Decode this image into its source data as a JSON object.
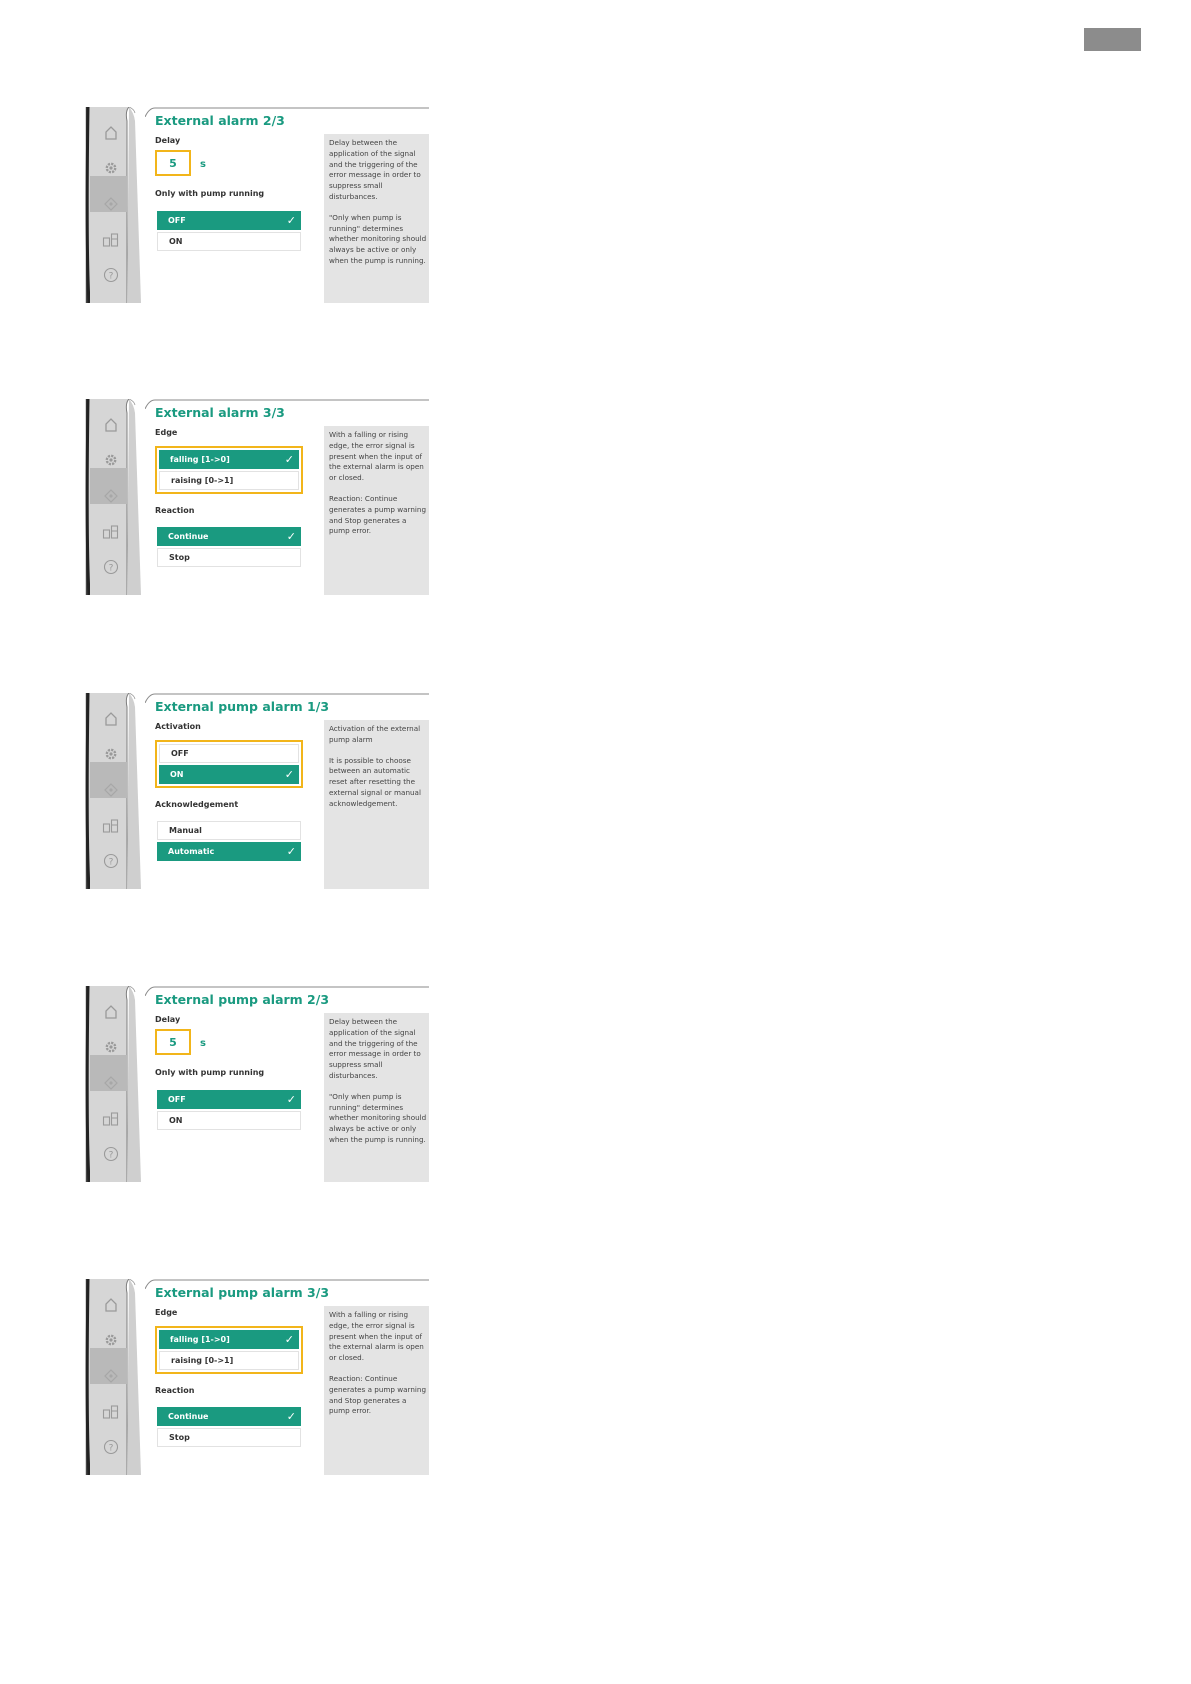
{
  "screens": [
    {
      "title": "External alarm 2/3",
      "delay_label": "Delay",
      "delay_value": "5",
      "delay_unit": "s",
      "group_label": "Only with pump running",
      "options": [
        {
          "label": "OFF",
          "selected": true
        },
        {
          "label": "ON",
          "selected": false
        }
      ],
      "help": [
        "Delay between the application of the signal and the triggering of the error message in order to suppress small disturbances.",
        "\"Only when pump is running\" determines whether monitoring should always be active or only when the pump is running."
      ]
    },
    {
      "title": "External alarm 3/3",
      "group1_label": "Edge",
      "group1_options": [
        {
          "label": "falling [1->0]",
          "selected": true
        },
        {
          "label": "raising [0->1]",
          "selected": false
        }
      ],
      "group2_label": "Reaction",
      "group2_options": [
        {
          "label": "Continue",
          "selected": true
        },
        {
          "label": "Stop",
          "selected": false
        }
      ],
      "help": [
        "With a falling or rising edge, the error signal is present when the input of the external alarm is open or closed.",
        "Reaction: Continue generates a pump warning and Stop generates a pump error."
      ]
    },
    {
      "title": "External pump alarm 1/3",
      "group1_label": "Activation",
      "group1_options": [
        {
          "label": "OFF",
          "selected": false
        },
        {
          "label": "ON",
          "selected": true
        }
      ],
      "group2_label": "Acknowledgement",
      "group2_options": [
        {
          "label": "Manual",
          "selected": false
        },
        {
          "label": "Automatic",
          "selected": true
        }
      ],
      "help": [
        "Activation of the external pump alarm",
        "It is possible to choose between an automatic reset after resetting the external signal or manual acknowledgement."
      ]
    },
    {
      "title": "External pump alarm 2/3",
      "delay_label": "Delay",
      "delay_value": "5",
      "delay_unit": "s",
      "group_label": "Only with pump running",
      "options": [
        {
          "label": "OFF",
          "selected": true
        },
        {
          "label": "ON",
          "selected": false
        }
      ],
      "help": [
        "Delay between the application of the signal and the triggering of the error message in order to suppress small disturbances.",
        "\"Only when pump is running\" determines whether monitoring should always be active or only when the pump is running."
      ]
    },
    {
      "title": "External pump alarm 3/3",
      "group1_label": "Edge",
      "group1_options": [
        {
          "label": "falling [1->0]",
          "selected": true
        },
        {
          "label": "raising [0->1]",
          "selected": false
        }
      ],
      "group2_label": "Reaction",
      "group2_options": [
        {
          "label": "Continue",
          "selected": true
        },
        {
          "label": "Stop",
          "selected": false
        }
      ],
      "help": [
        "With a falling or rising edge, the error signal is present when the input of the external alarm is open or closed.",
        "Reaction: Continue generates a pump warning and Stop generates a pump error."
      ]
    }
  ],
  "colors": {
    "accent": "#1a9a80",
    "focus": "#f2b51a",
    "help_bg": "#e4e4e4",
    "sidebar": "#d6d6d6",
    "sidebar_active": "#b9b9b9"
  },
  "sidebar_icons": [
    "home-icon",
    "gear-icon",
    "diagnostics-icon",
    "pump-settings-icon",
    "help-icon"
  ]
}
